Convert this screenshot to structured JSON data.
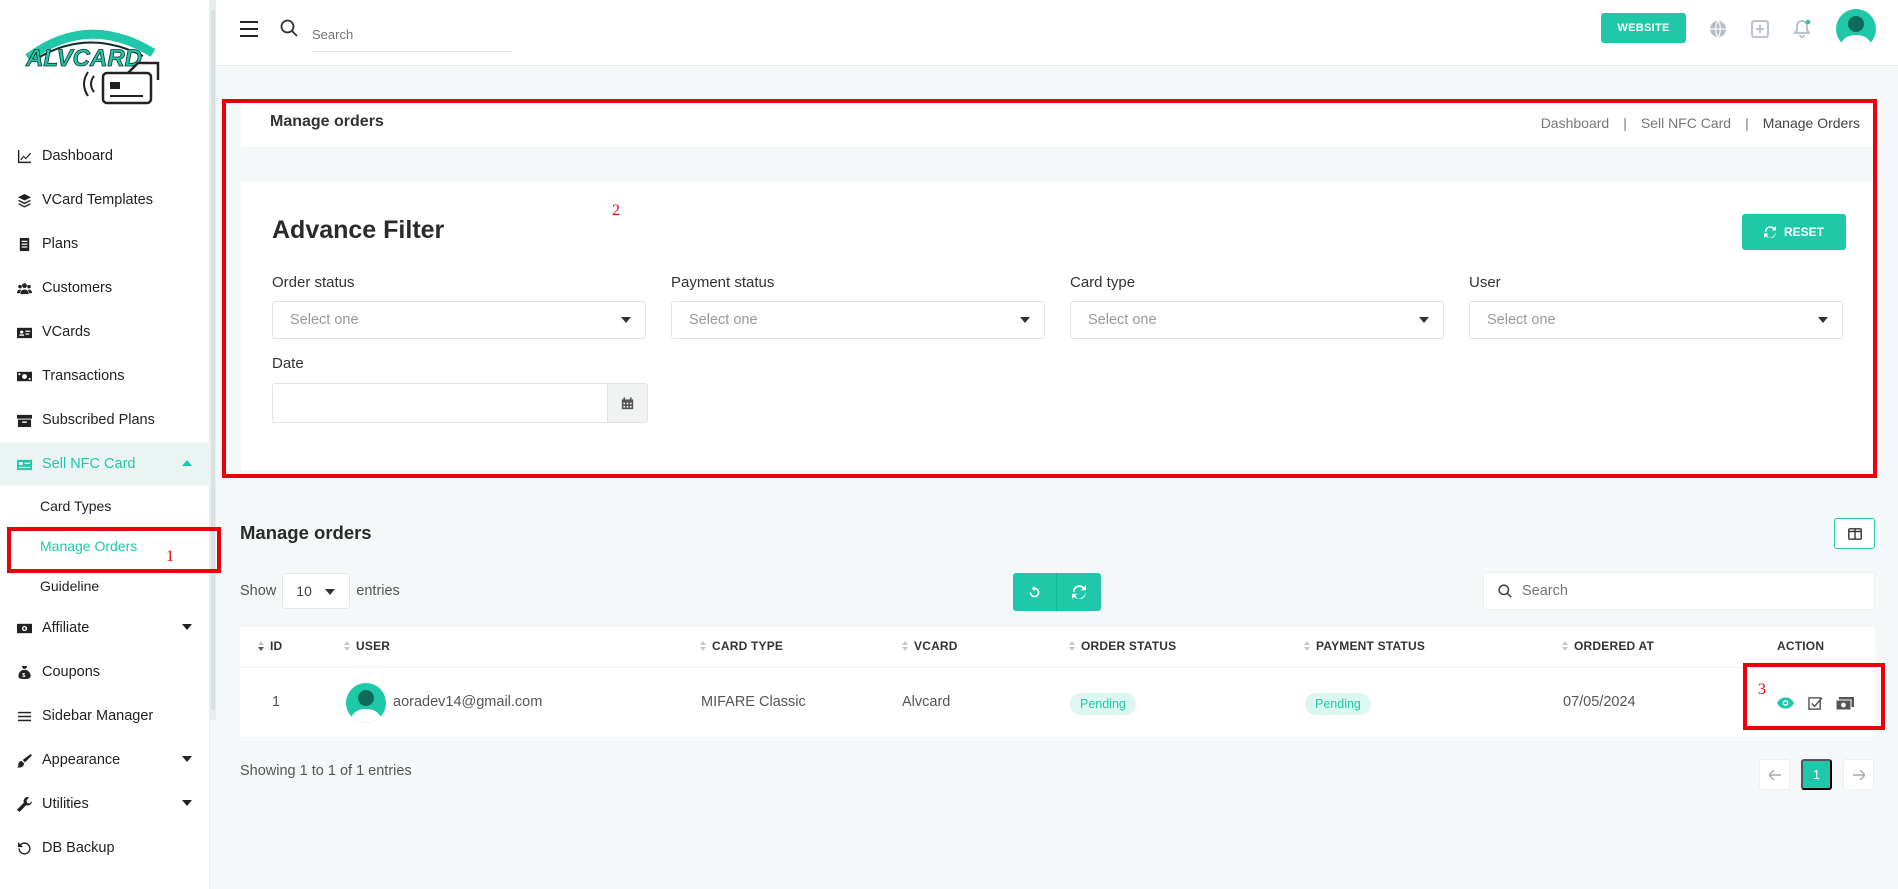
{
  "brand": {
    "name": "ALVCARD",
    "accent": "#1fc8a8",
    "highlight": "#e8000b"
  },
  "sidebar": {
    "items": [
      {
        "label": "Dashboard",
        "icon": "chart-line-icon"
      },
      {
        "label": "VCard Templates",
        "icon": "layers-icon"
      },
      {
        "label": "Plans",
        "icon": "document-icon"
      },
      {
        "label": "Customers",
        "icon": "users-icon"
      },
      {
        "label": "VCards",
        "icon": "id-card-icon"
      },
      {
        "label": "Transactions",
        "icon": "money-icon"
      },
      {
        "label": "Subscribed Plans",
        "icon": "archive-icon"
      },
      {
        "label": "Sell NFC Card",
        "icon": "nfc-card-icon"
      },
      {
        "label": "Affiliate",
        "icon": "affiliate-icon"
      },
      {
        "label": "Coupons",
        "icon": "coupon-icon"
      },
      {
        "label": "Sidebar Manager",
        "icon": "menu-icon"
      },
      {
        "label": "Appearance",
        "icon": "brush-icon"
      },
      {
        "label": "Utilities",
        "icon": "wrench-icon"
      },
      {
        "label": "DB Backup",
        "icon": "backup-icon"
      }
    ],
    "subitems": [
      {
        "label": "Card Types"
      },
      {
        "label": "Manage Orders"
      },
      {
        "label": "Guideline"
      }
    ]
  },
  "topbar": {
    "search_placeholder": "Search",
    "website_label": "WEBSITE"
  },
  "page": {
    "title": "Manage orders",
    "breadcrumb": [
      "Dashboard",
      "Sell NFC Card",
      "Manage Orders"
    ]
  },
  "filter": {
    "title": "Advance Filter",
    "reset_label": "RESET",
    "order_status_label": "Order status",
    "payment_status_label": "Payment status",
    "card_type_label": "Card type",
    "user_label": "User",
    "date_label": "Date",
    "select_placeholder": "Select one"
  },
  "orders": {
    "title": "Manage orders",
    "show_label": "Show",
    "entries_value": "10",
    "entries_label": "entries",
    "search_placeholder": "Search",
    "columns": [
      "ID",
      "USER",
      "CARD TYPE",
      "VCARD",
      "ORDER STATUS",
      "PAYMENT STATUS",
      "ORDERED AT",
      "ACTION"
    ],
    "rows": [
      {
        "id": "1",
        "user": "aoradev14@gmail.com",
        "card_type": "MIFARE Classic",
        "vcard": "Alvcard",
        "order_status": "Pending",
        "payment_status": "Pending",
        "ordered_at": "07/05/2024"
      }
    ],
    "showing": "Showing 1 to 1 of 1 entries",
    "current_page": "1"
  },
  "annotations": {
    "one": "1",
    "two": "2",
    "three": "3"
  }
}
